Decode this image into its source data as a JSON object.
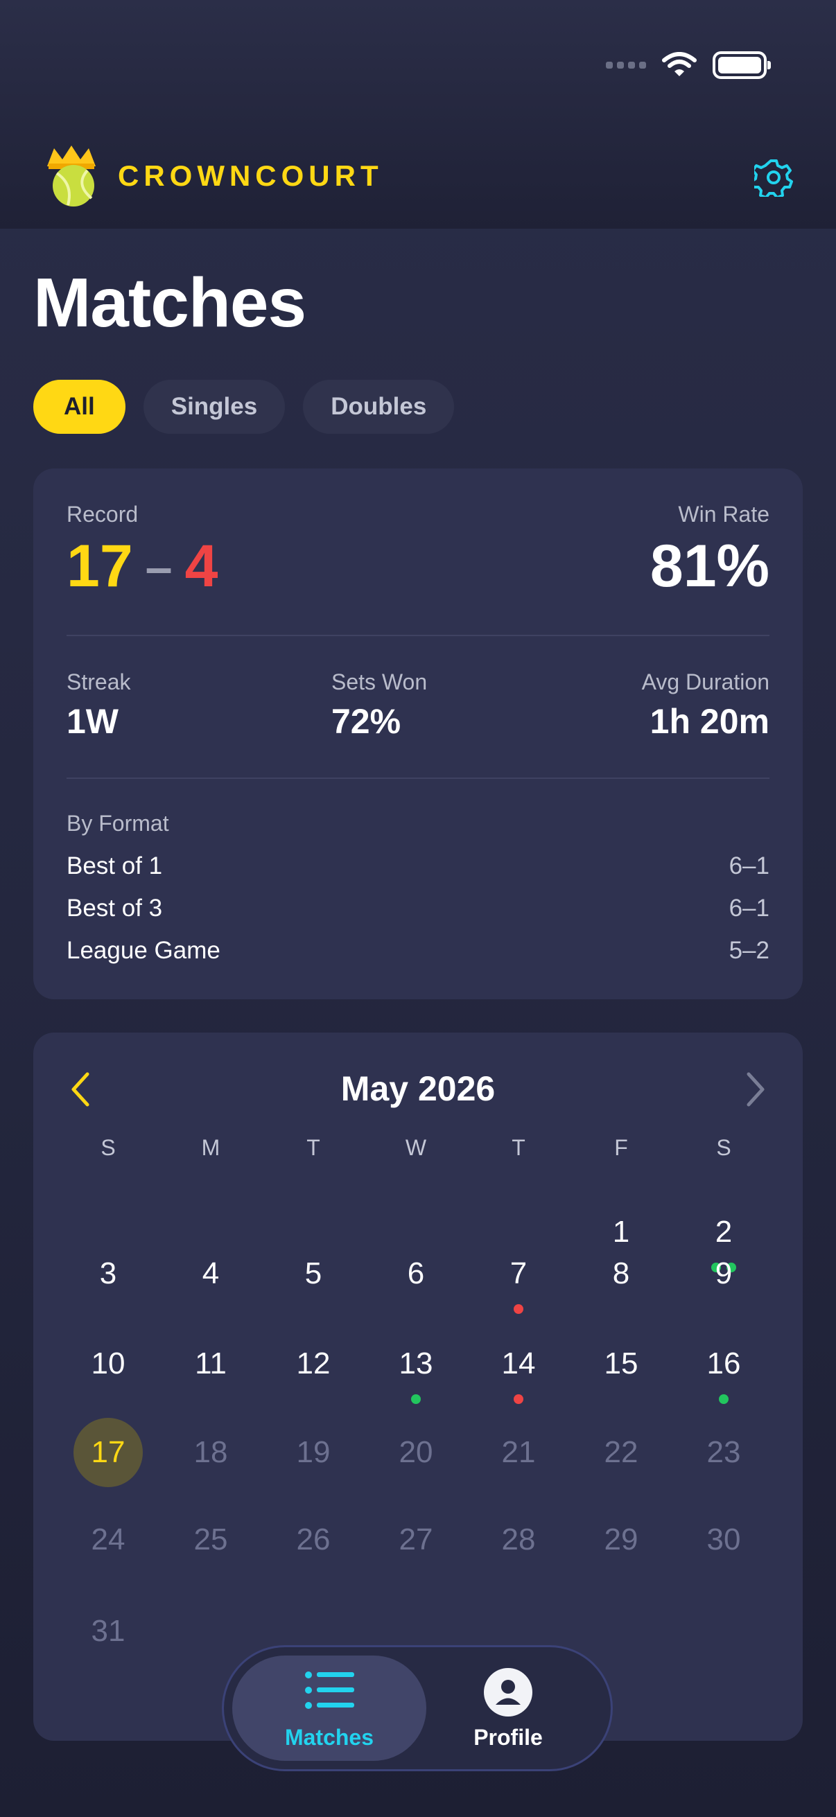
{
  "app": {
    "brand": "CROWNCOURT",
    "colors": {
      "accent": "#ffd814",
      "win": "#22c55e",
      "loss": "#ef4444",
      "active_tab": "#22d3ee"
    }
  },
  "header": {
    "settings_icon": "gear-icon",
    "logo_icon": "crown-tennis-ball-icon"
  },
  "page": {
    "title": "Matches"
  },
  "filters": {
    "all": "All",
    "singles": "Singles",
    "doubles": "Doubles",
    "selected": "All"
  },
  "stats": {
    "record_label": "Record",
    "wins": "17",
    "separator": "–",
    "losses": "4",
    "win_rate_label": "Win Rate",
    "win_rate": "81%",
    "streak_label": "Streak",
    "streak": "1W",
    "sets_won_label": "Sets Won",
    "sets_won": "72%",
    "avg_duration_label": "Avg Duration",
    "avg_duration": "1h 20m",
    "by_format_label": "By Format",
    "formats": [
      {
        "name": "Best of 1",
        "score": "6–1"
      },
      {
        "name": "Best of 3",
        "score": "6–1"
      },
      {
        "name": "League Game",
        "score": "5–2"
      }
    ]
  },
  "calendar": {
    "month": "May 2026",
    "weekdays": [
      "S",
      "M",
      "T",
      "W",
      "T",
      "F",
      "S"
    ],
    "first_weekday": 5,
    "days_in_month": 31,
    "today": 17,
    "results": {
      "2": [
        "win",
        "win"
      ],
      "7": [
        "loss"
      ],
      "13": [
        "win"
      ],
      "14": [
        "loss"
      ],
      "16": [
        "win"
      ]
    }
  },
  "tabbar": {
    "matches": "Matches",
    "profile": "Profile",
    "matches_icon": "list-icon",
    "profile_icon": "user-icon"
  }
}
